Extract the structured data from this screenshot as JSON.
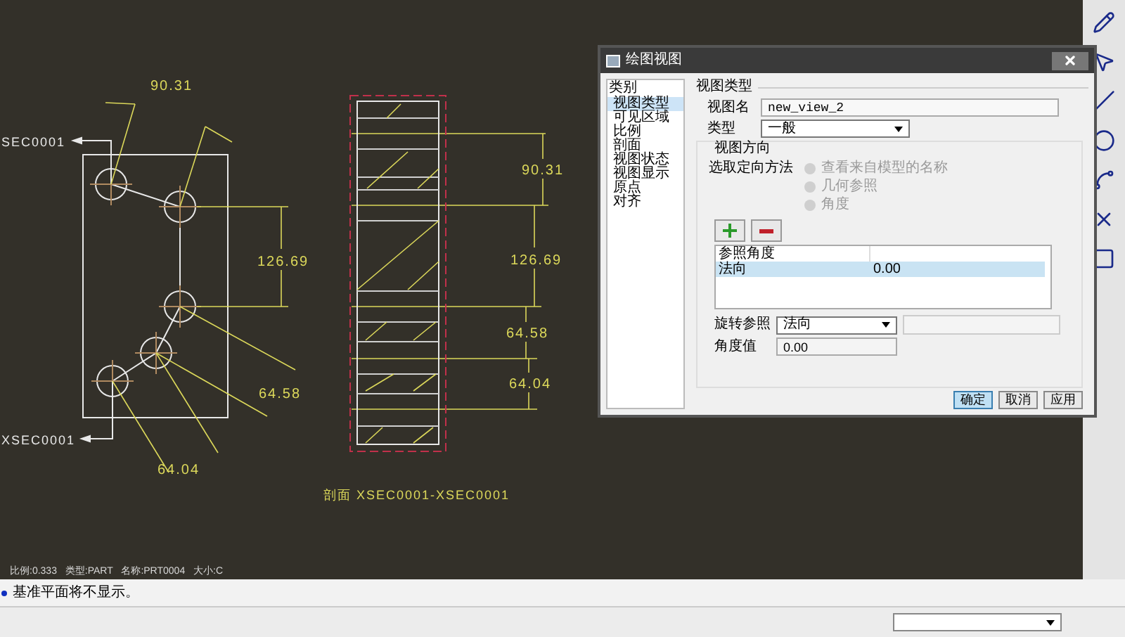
{
  "drawing": {
    "section_labels": [
      {
        "text": "SEC0001"
      },
      {
        "text": "XSEC0001"
      }
    ],
    "view_dimensions": [
      "90.31",
      "126.69",
      "64.58",
      "64.04"
    ],
    "section_dimensions": [
      "90.31",
      "126.69",
      "64.58",
      "64.04"
    ],
    "section_caption": {
      "prefix": "剖面",
      "name": "XSEC0001-XSEC0001"
    },
    "info": [
      "比例:0.333",
      "类型:PART",
      "名称:PRT0004",
      "大小:C"
    ]
  },
  "dialog": {
    "title": "绘图视图",
    "category": {
      "heading": "类别",
      "items": [
        {
          "label": "视图类型",
          "selected": true
        },
        {
          "label": "可见区域",
          "selected": false
        },
        {
          "label": "比例",
          "selected": false
        },
        {
          "label": "剖面",
          "selected": false
        },
        {
          "label": "视图状态",
          "selected": false
        },
        {
          "label": "视图显示",
          "selected": false
        },
        {
          "label": "原点",
          "selected": false
        },
        {
          "label": "对齐",
          "selected": false
        }
      ]
    },
    "section_title": "视图类型",
    "view_name": {
      "label": "视图名",
      "value": "new_view_2"
    },
    "type": {
      "label": "类型",
      "value": "一般"
    },
    "orientation": {
      "title": "视图方向",
      "method_label": "选取定向方法",
      "options": [
        {
          "label": "查看来自模型的名称",
          "selected": false,
          "disabled": true
        },
        {
          "label": "几何参照",
          "selected": false,
          "disabled": true
        },
        {
          "label": "角度",
          "selected": false,
          "disabled": true
        }
      ]
    },
    "table": {
      "columns": [
        "参照角度"
      ],
      "rows": [
        {
          "cells": [
            "法向",
            "0.00"
          ],
          "selected": true
        }
      ]
    },
    "rotation_ref": {
      "label": "旋转参照",
      "value": "法向"
    },
    "angle": {
      "label": "角度值",
      "value": "0.00"
    },
    "buttons": [
      {
        "label": "确定",
        "default": true
      },
      {
        "label": "取消",
        "default": false
      },
      {
        "label": "应用",
        "default": false
      }
    ]
  },
  "message": "基准平面将不显示。"
}
